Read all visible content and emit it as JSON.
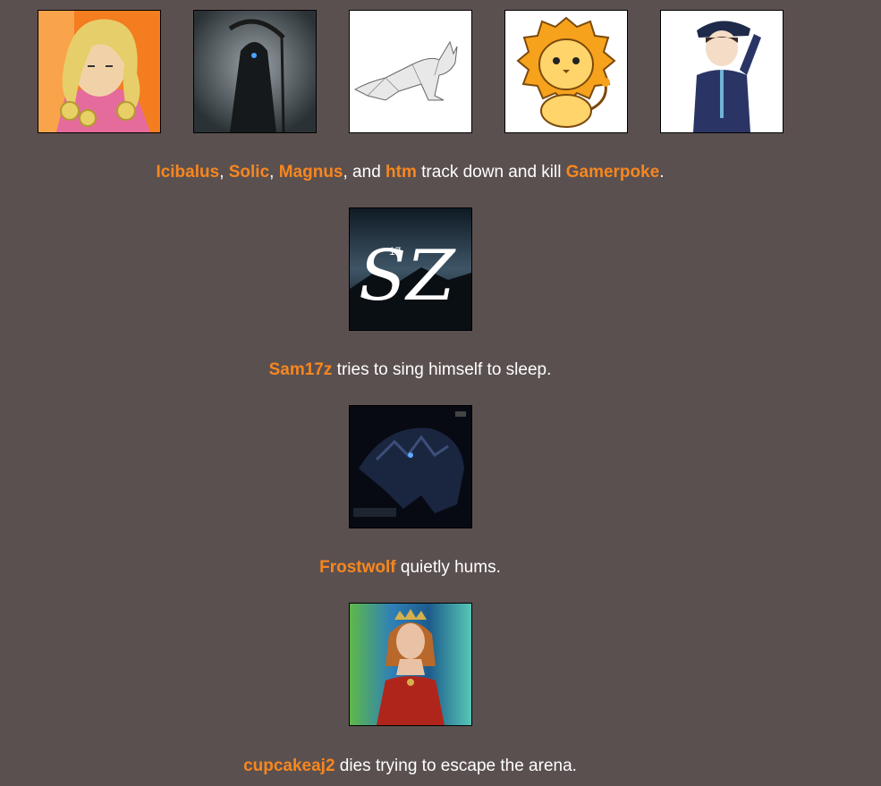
{
  "colors": {
    "background": "#5b5050",
    "name_accent": "#f7871f",
    "text": "#ffffff"
  },
  "events": [
    {
      "avatars": [
        "blonde-curly-hair-character",
        "hooded-reaper-with-scythe",
        "low-poly-kangaroo-sketch",
        "cartoon-lion",
        "anime-boy-in-suit"
      ],
      "names": [
        "Icibalus",
        "Solic",
        "Magnus",
        "htm",
        "Gamerpoke"
      ],
      "sep1": ", ",
      "sep2": ", ",
      "sep3": ", and ",
      "action": " track down and kill ",
      "end": "."
    },
    {
      "avatars": [
        "sz17-logo"
      ],
      "logo_letters": "SZ",
      "logo_number": "17",
      "name": "Sam17z",
      "action": " tries to sing himself to sleep."
    },
    {
      "avatars": [
        "dark-dragon-head"
      ],
      "name": "Frostwolf",
      "action": " quietly hums."
    },
    {
      "avatars": [
        "woman-in-red-dress-with-crown"
      ],
      "name": "cupcakeaj2",
      "action": " dies trying to escape the arena."
    }
  ]
}
